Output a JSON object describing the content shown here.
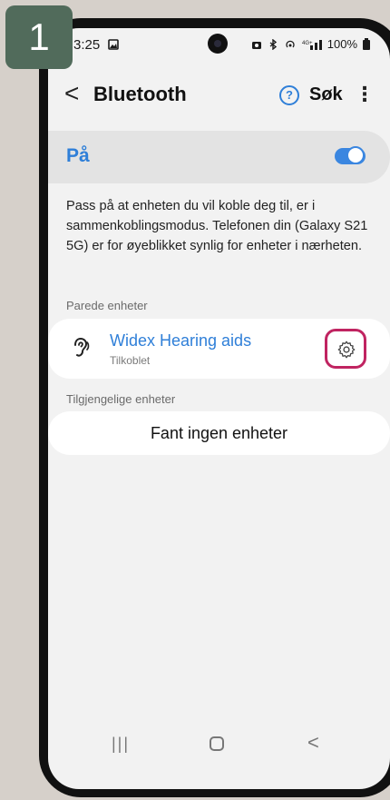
{
  "step": {
    "number": "1"
  },
  "status_bar": {
    "time": "3:25",
    "battery": "100%",
    "icons": [
      "image-icon",
      "camera-icon",
      "nfc-icon",
      "bluetooth-icon",
      "hotspot-icon",
      "signal-icon",
      "battery-icon"
    ]
  },
  "header": {
    "title": "Bluetooth",
    "search_label": "Søk",
    "help_glyph": "?",
    "more_glyph": "⋮",
    "back_glyph": "<"
  },
  "toggle_row": {
    "label": "På",
    "state": "on"
  },
  "info_text": "Pass på at enheten du vil koble deg til, er i sammenkoblingsmodus. Telefonen din (Galaxy S21 5G) er for øyeblikket synlig for enheter i nærheten.",
  "paired": {
    "section_label": "Parede enheter",
    "devices": [
      {
        "name": "Widex Hearing aids",
        "status": "Tilkoblet"
      }
    ]
  },
  "available": {
    "section_label": "Tilgjengelige enheter",
    "empty_text": "Fant ingen enheter"
  },
  "colors": {
    "accent": "#2f7fd8",
    "highlight": "#c02461",
    "badge": "#516b5b"
  }
}
